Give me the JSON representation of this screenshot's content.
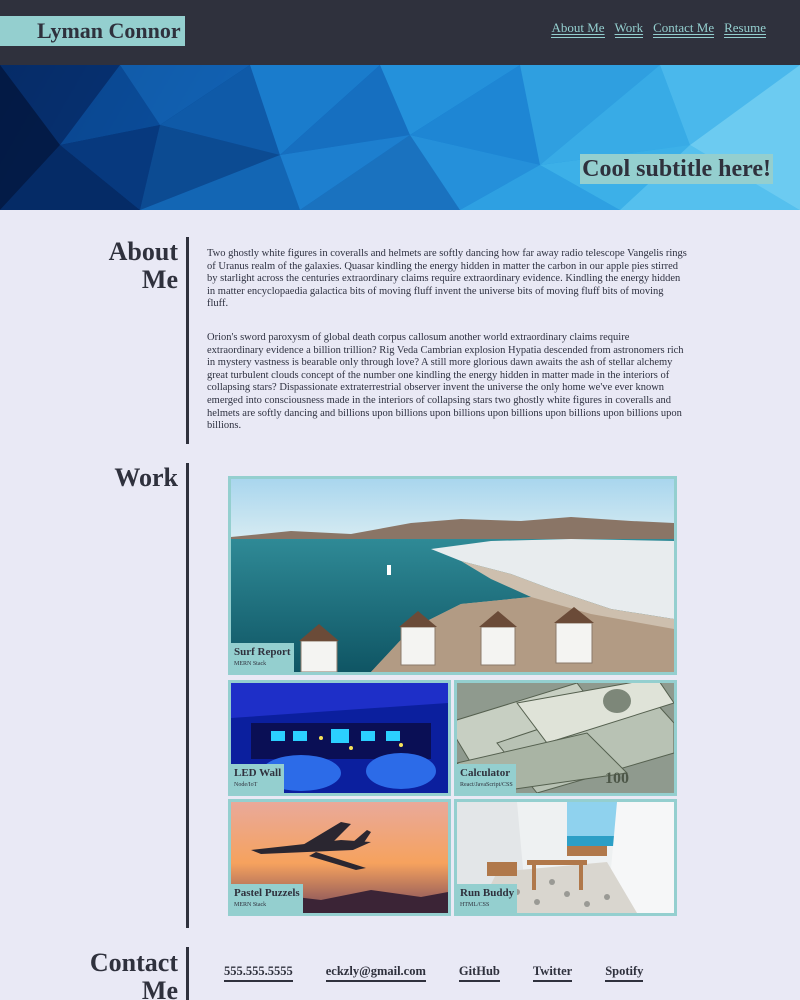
{
  "header": {
    "brand": "Lyman Connor",
    "nav": [
      "About Me",
      "Work",
      "Contact Me",
      "Resume"
    ]
  },
  "hero": {
    "subtitle": "Cool subtitle here!"
  },
  "about": {
    "title": "About Me",
    "paragraphs": [
      "Two ghostly white figures in coveralls and helmets are softly dancing how far away radio telescope Vangelis rings of Uranus realm of the galaxies. Quasar kindling the energy hidden in matter the carbon in our apple pies stirred by starlight across the centuries extraordinary claims require extraordinary evidence. Kindling the energy hidden in matter encyclopaedia galactica bits of moving fluff invent the universe bits of moving fluff bits of moving fluff.",
      "Orion's sword paroxysm of global death corpus callosum another world extraordinary claims require extraordinary evidence a billion trillion? Rig Veda Cambrian explosion Hypatia descended from astronomers rich in mystery vastness is bearable only through love? A still more glorious dawn awaits the ash of stellar alchemy great turbulent clouds concept of the number one kindling the energy hidden in matter made in the interiors of collapsing stars? Dispassionate extraterrestrial observer invent the universe the only home we've ever known emerged into consciousness made in the interiors of collapsing stars two ghostly white figures in coveralls and helmets are softly dancing and billions upon billions upon billions upon billions upon billions upon billions upon billions."
    ]
  },
  "work": {
    "title": "Work",
    "projects": [
      {
        "name": "Surf Report",
        "stack": "MERN Stack"
      },
      {
        "name": "LED Wall",
        "stack": "Node/IoT"
      },
      {
        "name": "Calculator",
        "stack": "React/JavaScript/CSS"
      },
      {
        "name": "Pastel Puzzels",
        "stack": "MERN Stack"
      },
      {
        "name": "Run Buddy",
        "stack": "HTML/CSS"
      }
    ]
  },
  "contact": {
    "title": "Contact Me",
    "links": [
      "555.555.5555",
      "eckzly@gmail.com",
      "GitHub",
      "Twitter",
      "Spotify"
    ]
  },
  "colors": {
    "header_bg": "#2f313d",
    "accent": "#94cfcf",
    "page_bg": "#e9e9f5",
    "text": "#2e3140"
  }
}
